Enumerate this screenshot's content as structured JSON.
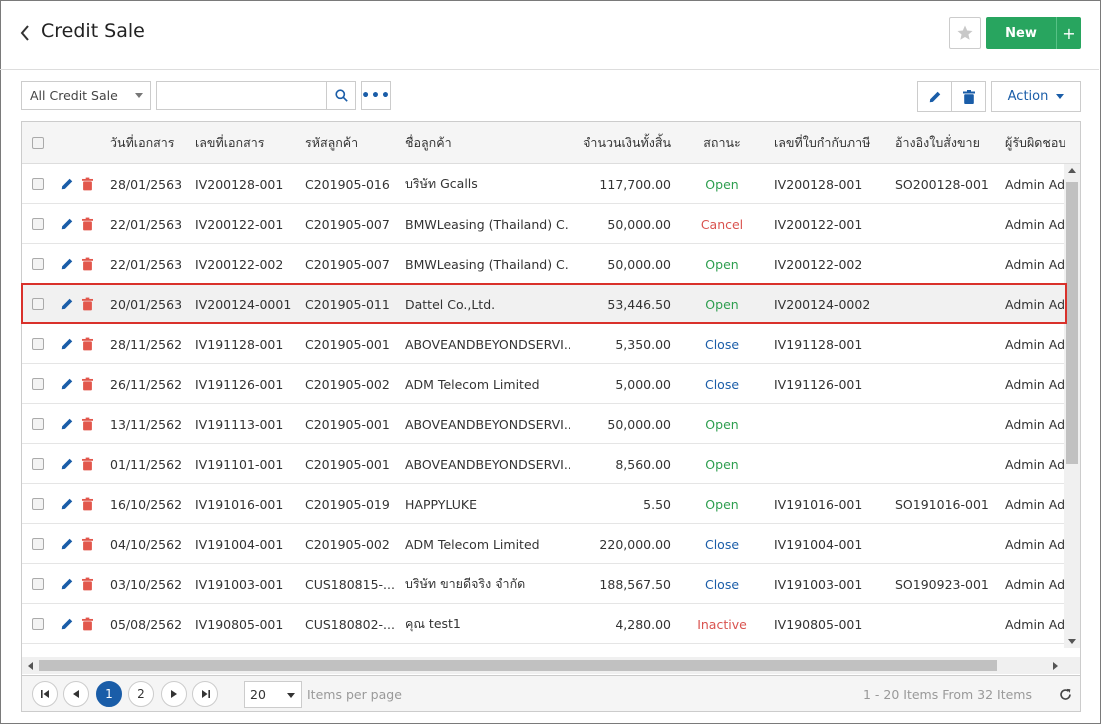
{
  "header": {
    "title": "Credit Sale",
    "new_label": "New",
    "plus_label": "+"
  },
  "toolbar": {
    "filter_selected": "All Credit Sale",
    "search_value": "",
    "more_label": "•••",
    "action_label": "Action"
  },
  "columns": {
    "doc_date": "วันที่เอกสาร",
    "doc_no": "เลขที่เอกสาร",
    "cust_code": "รหัสลูกค้า",
    "cust_name": "ชื่อลูกค้า",
    "total": "จำนวนเงินทั้งสิ้น",
    "status": "สถานะ",
    "tax_invoice": "เลขที่ใบกำกับภาษี",
    "so_ref": "อ้างอิงใบสั่งขาย",
    "owner": "ผู้รับผิดชอบ"
  },
  "rows": [
    {
      "date": "28/01/2563",
      "doc": "IV200128-001",
      "code": "C201905-016",
      "name": "บริษัท Gcalls",
      "total": "117,700.00",
      "status": "Open",
      "tax": "IV200128-001",
      "so": "SO200128-001",
      "owner": "Admin Adm"
    },
    {
      "date": "22/01/2563",
      "doc": "IV200122-001",
      "code": "C201905-007",
      "name": "BMWLeasing (Thailand) C...",
      "total": "50,000.00",
      "status": "Cancel",
      "tax": "IV200122-001",
      "so": "",
      "owner": "Admin Adm"
    },
    {
      "date": "22/01/2563",
      "doc": "IV200122-002",
      "code": "C201905-007",
      "name": "BMWLeasing (Thailand) C...",
      "total": "50,000.00",
      "status": "Open",
      "tax": "IV200122-002",
      "so": "",
      "owner": "Admin Adm"
    },
    {
      "date": "20/01/2563",
      "doc": "IV200124-0001",
      "code": "C201905-011",
      "name": "Dattel Co.,Ltd.",
      "total": "53,446.50",
      "status": "Open",
      "tax": "IV200124-0002",
      "so": "",
      "owner": "Admin Adm"
    },
    {
      "date": "28/11/2562",
      "doc": "IV191128-001",
      "code": "C201905-001",
      "name": "ABOVEANDBEYONDSERVI...",
      "total": "5,350.00",
      "status": "Close",
      "tax": "IV191128-001",
      "so": "",
      "owner": "Admin Adm"
    },
    {
      "date": "26/11/2562",
      "doc": "IV191126-001",
      "code": "C201905-002",
      "name": "ADM Telecom Limited",
      "total": "5,000.00",
      "status": "Close",
      "tax": "IV191126-001",
      "so": "",
      "owner": "Admin Adm"
    },
    {
      "date": "13/11/2562",
      "doc": "IV191113-001",
      "code": "C201905-001",
      "name": "ABOVEANDBEYONDSERVI...",
      "total": "50,000.00",
      "status": "Open",
      "tax": "",
      "so": "",
      "owner": "Admin Adm"
    },
    {
      "date": "01/11/2562",
      "doc": "IV191101-001",
      "code": "C201905-001",
      "name": "ABOVEANDBEYONDSERVI...",
      "total": "8,560.00",
      "status": "Open",
      "tax": "",
      "so": "",
      "owner": "Admin Adm"
    },
    {
      "date": "16/10/2562",
      "doc": "IV191016-001",
      "code": "C201905-019",
      "name": "HAPPYLUKE",
      "total": "5.50",
      "status": "Open",
      "tax": "IV191016-001",
      "so": "SO191016-001",
      "owner": "Admin Adm"
    },
    {
      "date": "04/10/2562",
      "doc": "IV191004-001",
      "code": "C201905-002",
      "name": "ADM Telecom Limited",
      "total": "220,000.00",
      "status": "Close",
      "tax": "IV191004-001",
      "so": "",
      "owner": "Admin Adm"
    },
    {
      "date": "03/10/2562",
      "doc": "IV191003-001",
      "code": "CUS180815-...",
      "name": "บริษัท ขายดีจริง จำกัด",
      "total": "188,567.50",
      "status": "Close",
      "tax": "IV191003-001",
      "so": "SO190923-001",
      "owner": "Admin Adm"
    },
    {
      "date": "05/08/2562",
      "doc": "IV190805-001",
      "code": "CUS180802-...",
      "name": "คุณ test1",
      "total": "4,280.00",
      "status": "Inactive",
      "tax": "IV190805-001",
      "so": "",
      "owner": "Admin Adm"
    }
  ],
  "selected_row_index": 3,
  "status_colors": {
    "Open": "#2e9e4f",
    "Cancel": "#d9534f",
    "Close": "#1a5da8",
    "Inactive": "#d9534f"
  },
  "pager": {
    "pages": [
      "1",
      "2"
    ],
    "current_page": "1",
    "page_size": "20",
    "items_per_page_label": "Items per page",
    "info": "1 - 20 Items From 32 Items"
  },
  "icons": {
    "back": "chevron-left-icon",
    "favorite": "star-icon",
    "search": "magnifier-icon",
    "edit": "pencil-icon",
    "delete": "trash-icon",
    "refresh": "refresh-icon"
  }
}
